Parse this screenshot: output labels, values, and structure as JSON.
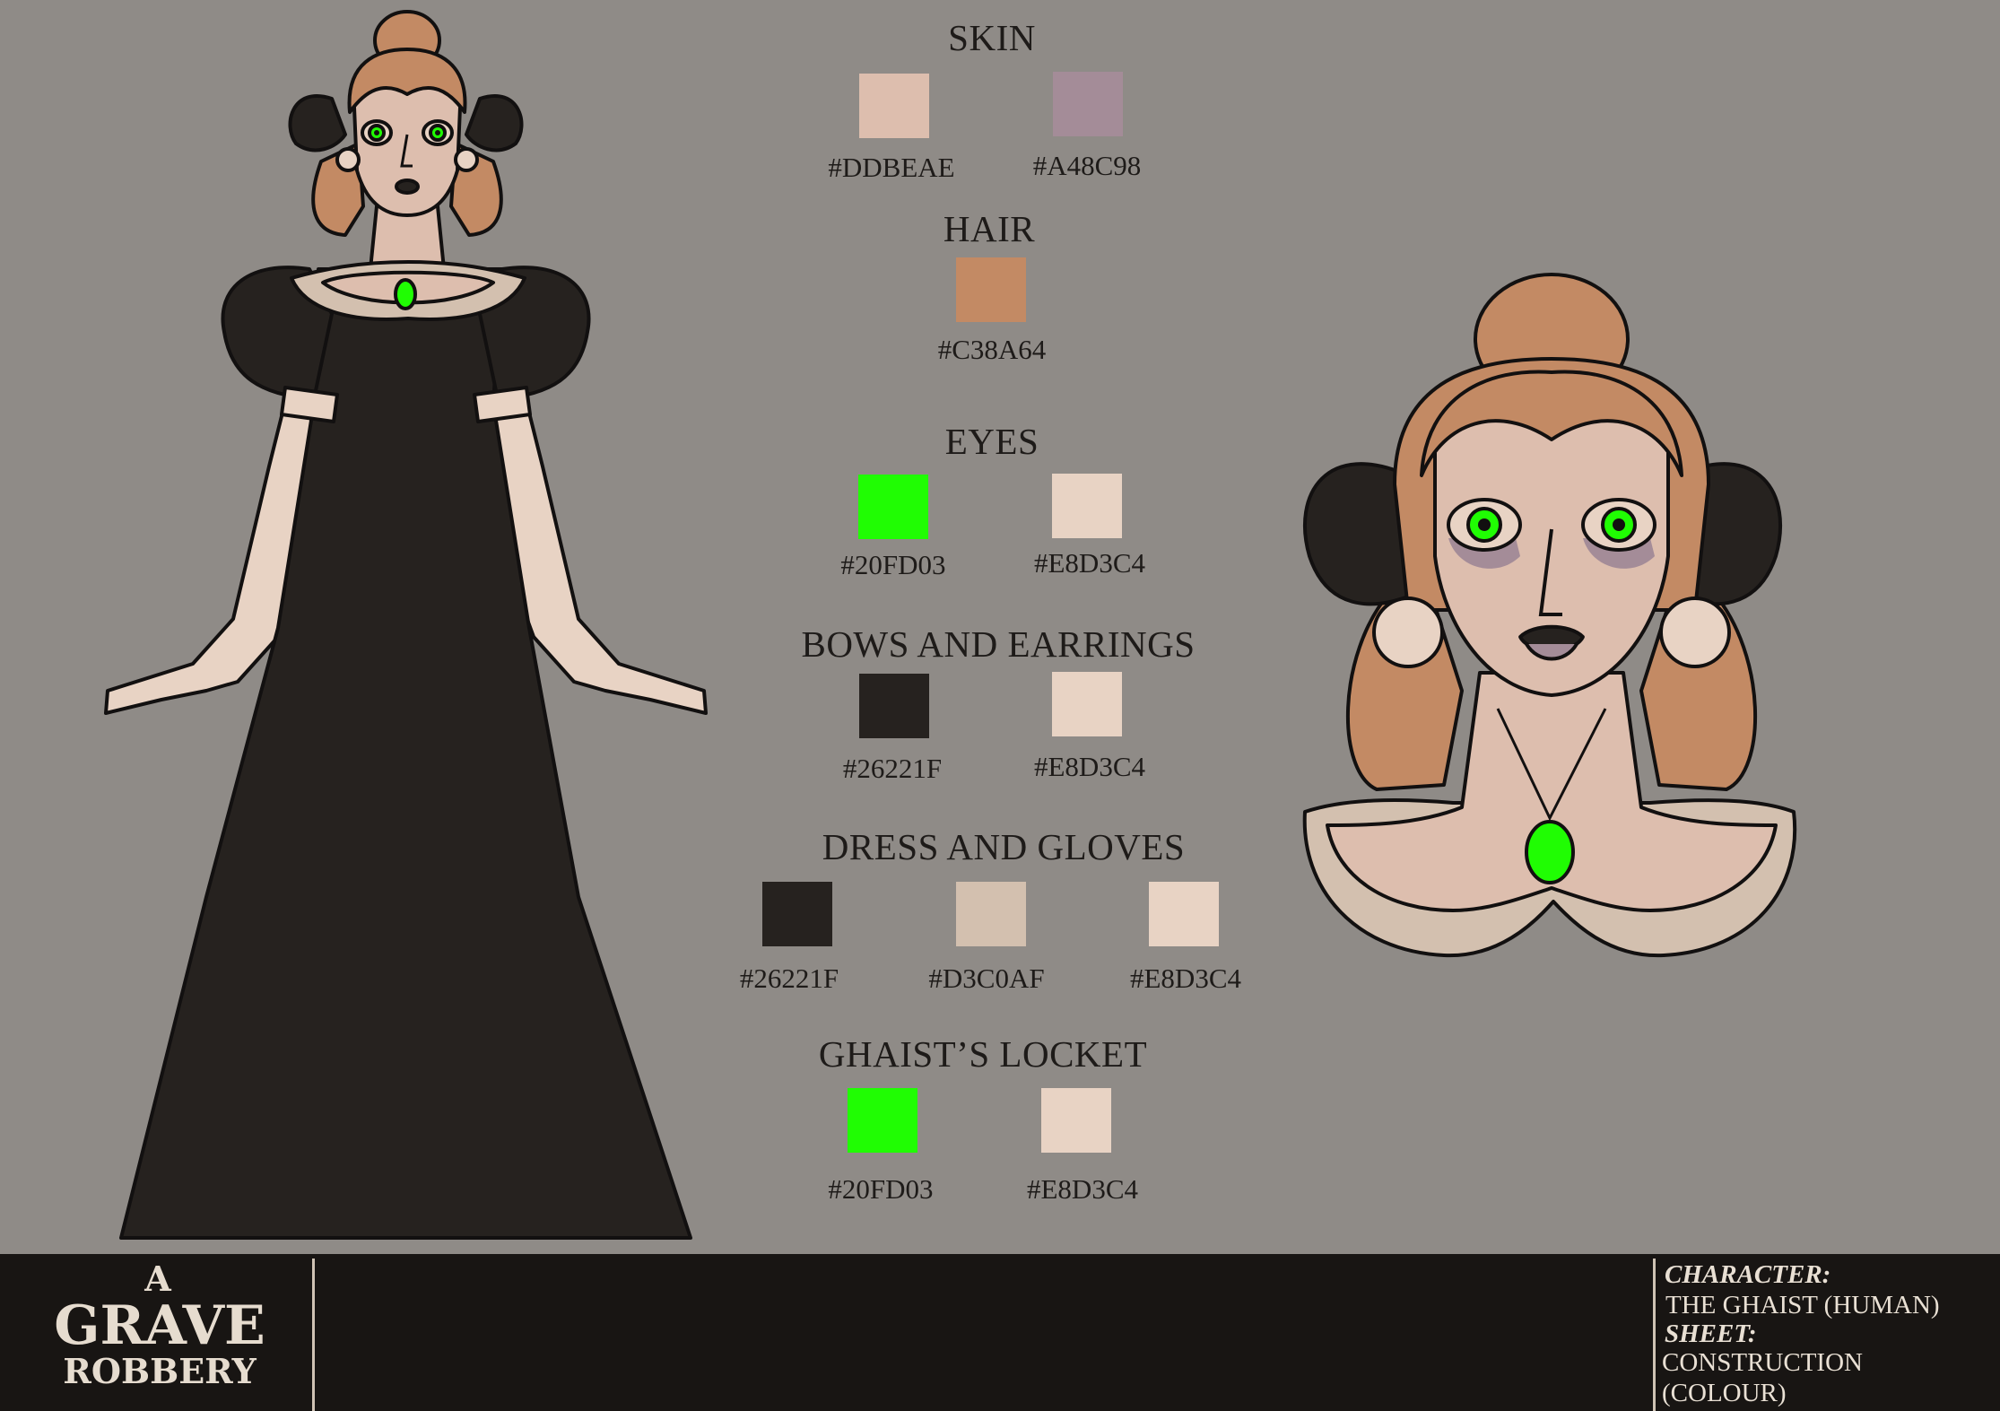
{
  "sections": [
    {
      "title": "SKIN",
      "swatches": [
        {
          "hex": "#DDBEAE",
          "label": "#DDBEAE"
        },
        {
          "hex": "#A48C98",
          "label": "#A48C98"
        }
      ]
    },
    {
      "title": "HAIR",
      "swatches": [
        {
          "hex": "#C38A64",
          "label": "#C38A64"
        }
      ]
    },
    {
      "title": "EYES",
      "swatches": [
        {
          "hex": "#20FD03",
          "label": "#20FD03"
        },
        {
          "hex": "#E8D3C4",
          "label": "#E8D3C4"
        }
      ]
    },
    {
      "title": "BOWS AND EARRINGS",
      "swatches": [
        {
          "hex": "#26221F",
          "label": "#26221F"
        },
        {
          "hex": "#E8D3C4",
          "label": "#E8D3C4"
        }
      ]
    },
    {
      "title": "DRESS AND GLOVES",
      "swatches": [
        {
          "hex": "#26221F",
          "label": "#26221F"
        },
        {
          "hex": "#D3C0AF",
          "label": "#D3C0AF"
        },
        {
          "hex": "#E8D3C4",
          "label": "#E8D3C4"
        }
      ]
    },
    {
      "title": "GHAIST’S LOCKET",
      "swatches": [
        {
          "hex": "#20FD03",
          "label": "#20FD03"
        },
        {
          "hex": "#E8D3C4",
          "label": "#E8D3C4"
        }
      ]
    }
  ],
  "logo": {
    "line1": "A",
    "line2": "GRAVE",
    "line3": "ROBBERY"
  },
  "info": {
    "character_label": "CHARACTER:",
    "character_value": "THE GHAIST (HUMAN)",
    "sheet_label": "SHEET:",
    "sheet_value_1": "CONSTRUCTION",
    "sheet_value_2": "(COLOUR)"
  },
  "colors": {
    "background": "#8F8B87",
    "footer": "#181513",
    "skin": "#DDBEAE",
    "hair": "#C38A64",
    "eyes": "#20FD03",
    "dress": "#26221F"
  }
}
